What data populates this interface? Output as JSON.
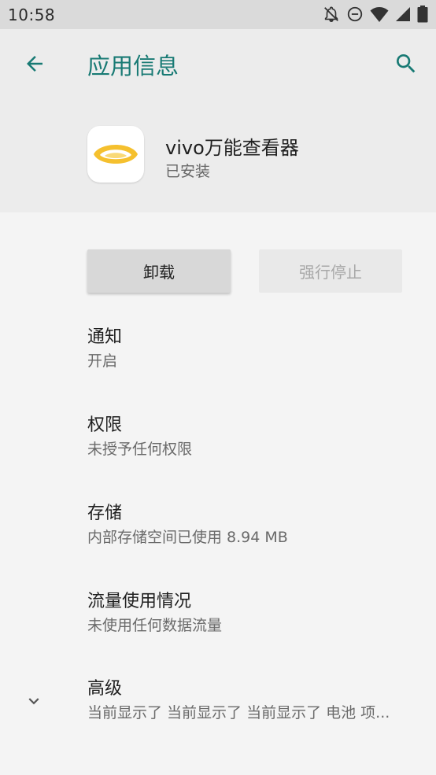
{
  "status_bar": {
    "time": "10:58",
    "icons": [
      "notifications-off-icon",
      "do-not-disturb-icon",
      "wifi-icon",
      "cell-signal-icon",
      "battery-icon"
    ]
  },
  "header": {
    "title": "应用信息",
    "back_icon": "arrow-left-icon",
    "search_icon": "search-icon"
  },
  "app": {
    "name": "vivo万能查看器",
    "status": "已安装",
    "icon": "eye-logo-icon"
  },
  "buttons": {
    "uninstall": "卸载",
    "force_stop": "强行停止"
  },
  "items": [
    {
      "title": "通知",
      "subtitle": "开启"
    },
    {
      "title": "权限",
      "subtitle": "未授予任何权限"
    },
    {
      "title": "存储",
      "subtitle": "内部存储空间已使用 8.94 MB"
    },
    {
      "title": "流量使用情况",
      "subtitle": "未使用任何数据流量"
    },
    {
      "title": "高级",
      "subtitle": "当前显示了 当前显示了 当前显示了 电池 项..."
    }
  ],
  "colors": {
    "accent": "#187a74",
    "header_bg": "#ececec",
    "page_bg": "#f4f4f4",
    "logo_yellow": "#f5c02e"
  }
}
